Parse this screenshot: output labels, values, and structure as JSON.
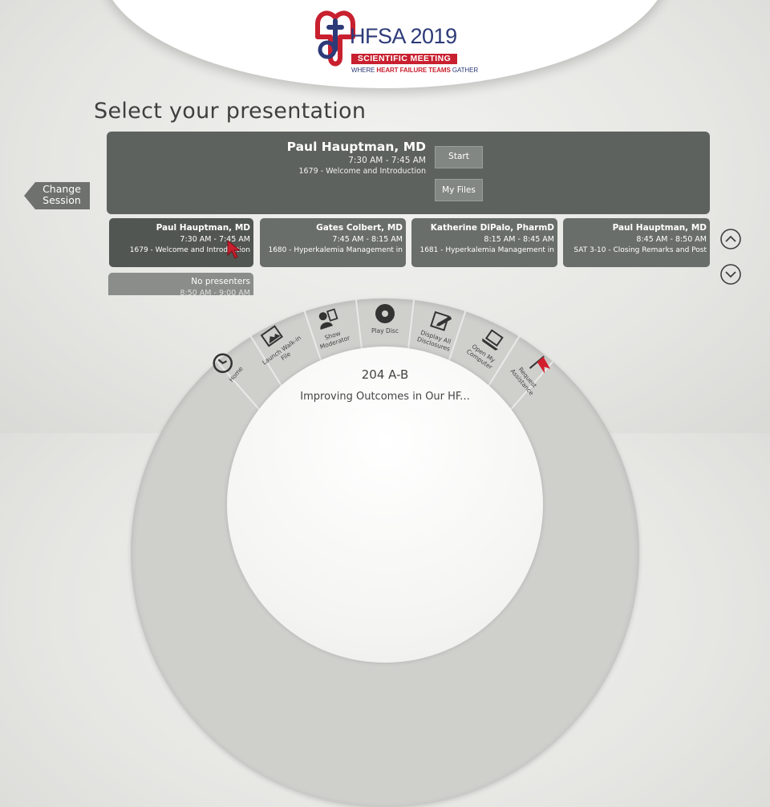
{
  "header": {
    "logo_title": "HFSA 2019",
    "logo_band": "SCIENTIFIC MEETING",
    "logo_tag_pre": "WHERE ",
    "logo_tag_bold": "HEART FAILURE TEAMS",
    "logo_tag_post": " GATHER",
    "logo_color_red": "#c8202f",
    "logo_color_navy": "#2d3a78"
  },
  "page_title": "Select your presentation",
  "featured": {
    "presenter": "Paul Hauptman, MD",
    "time": "7:30 AM - 7:45 AM",
    "title": "1679 - Welcome and Introduction",
    "start_label": "Start",
    "files_label": "My Files"
  },
  "change_session": {
    "line1": "Change",
    "line2": "Session"
  },
  "presentations": [
    {
      "presenter": "Paul Hauptman, MD",
      "time": "7:30 AM - 7:45 AM",
      "title": "1679 - Welcome and Introduction",
      "selected": true
    },
    {
      "presenter": "Gates Colbert, MD",
      "time": "7:45 AM - 8:15 AM",
      "title": "1680 - Hyperkalemia Management in"
    },
    {
      "presenter": "Katherine DiPalo, PharmD",
      "time": "8:15 AM - 8:45 AM",
      "title": "1681 - Hyperkalemia Management in"
    },
    {
      "presenter": "Paul Hauptman, MD",
      "time": "8:45 AM - 8:50 AM",
      "title": "SAT 3-10 - Closing Remarks and Post"
    }
  ],
  "second_row": [
    {
      "presenter": "No presenters",
      "time": "8:50 AM - 9:00 AM"
    }
  ],
  "menu": [
    {
      "label": "Home",
      "icon": "clock-icon"
    },
    {
      "label": "Launch Walk-in File",
      "icon": "image-file-icon"
    },
    {
      "label": "Show Moderator",
      "icon": "moderator-icon"
    },
    {
      "label": "Play Disc",
      "icon": "disc-icon"
    },
    {
      "label": "Display All Disclosures",
      "icon": "edit-icon"
    },
    {
      "label": "Open My Computer",
      "icon": "laptop-icon"
    },
    {
      "label": "Request Assistance",
      "icon": "flag-icon"
    }
  ],
  "room": "204 A-B",
  "session_title": "Improving Outcomes in Our HF..."
}
